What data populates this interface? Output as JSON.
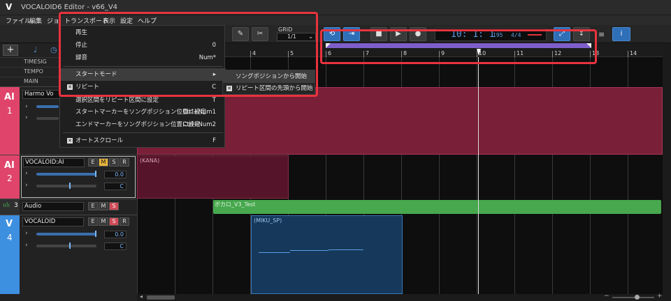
{
  "app": {
    "logo": "V",
    "title": "VOCALOID6 Editor - v66_V4"
  },
  "menubar": [
    {
      "label": "ファイル"
    },
    {
      "label": "編集"
    },
    {
      "label": "ジョ"
    },
    {
      "label": "トランスポート"
    },
    {
      "label": "表示"
    },
    {
      "label": "設定"
    },
    {
      "label": "ヘルプ"
    }
  ],
  "toolbar": {
    "grid_label": "GRID",
    "grid_value": "1/1",
    "lcd_time": "10: 1: 1",
    "lcd_tempo": "195",
    "lcd_sig": "4/4"
  },
  "ruler": {
    "labels": [
      "4",
      "5",
      "6",
      "7",
      "8",
      "9",
      "10",
      "11",
      "12",
      "13",
      "14"
    ]
  },
  "header_rows": [
    "TIMESIG",
    "TEMPO",
    "MAIN"
  ],
  "dropdown": [
    {
      "label": "再生",
      "key": ""
    },
    {
      "label": "停止",
      "key": "0"
    },
    {
      "label": "録音",
      "key": "Num*"
    },
    {
      "label": "スタートモード",
      "key": "▸",
      "highlight": true
    },
    {
      "label": "リピート",
      "key": "C",
      "checked": true
    },
    {
      "label": "選択区間をリピート区間に設定",
      "key": "T"
    },
    {
      "label": "スタートマーカーをソングポジション位置に設定",
      "key": "Ctrl+Num1"
    },
    {
      "label": "エンドマーカーをソングポジション位置に設定",
      "key": "Ctrl+Num2"
    },
    {
      "label": "オートスクロール",
      "key": "F",
      "checked": true
    }
  ],
  "submenu": [
    {
      "label": "ソングポジションから開始"
    },
    {
      "label": "リピート区間の先頭から開始",
      "checked": true
    }
  ],
  "tracks": {
    "t1": {
      "badge": "AI",
      "num": "1",
      "name": "Harmo Vo"
    },
    "t2": {
      "badge": "AI",
      "num": "2",
      "name": "VOCALOID:AI",
      "vol": "0.0",
      "pan": "C"
    },
    "t3": {
      "num": "3",
      "name": "Audio"
    },
    "t4": {
      "badge": "V",
      "num": "4",
      "name": "VOCALOID",
      "vol": "0.0",
      "pan": "C"
    }
  },
  "parts": {
    "kana": "(KANA)",
    "audio": "ボカロ_V3_Test",
    "miku": "(MIKU_SP)"
  },
  "colors": {
    "accent_red": "#e8333e",
    "loop": "#7e5fc9",
    "ai_track": "#e0446a",
    "v_track": "#3d8fe0",
    "audio_wave": "#47a84e"
  }
}
